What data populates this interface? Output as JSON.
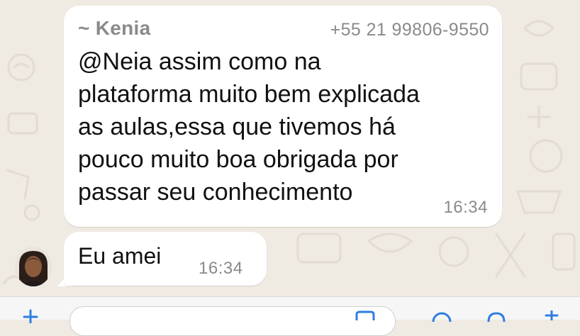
{
  "chat": {
    "messages": [
      {
        "sender_name": "~ Kenia",
        "sender_phone": "+55 21 99806-9550",
        "text": "@Neia assim como na\nplataforma muito bem explicada\nas aulas,essa que tivemos há\npouco muito boa obrigada por\npassar seu conhecimento",
        "time": "16:34"
      },
      {
        "text": "Eu amei",
        "time": "16:34"
      }
    ]
  },
  "colors": {
    "wallpaper": "#efeae2",
    "bubble": "#ffffff",
    "meta_text": "#8a8a8a",
    "message_text": "#111111"
  },
  "icons": [
    "plus-icon",
    "sticker-icon",
    "camera-icon",
    "microphone-icon"
  ]
}
